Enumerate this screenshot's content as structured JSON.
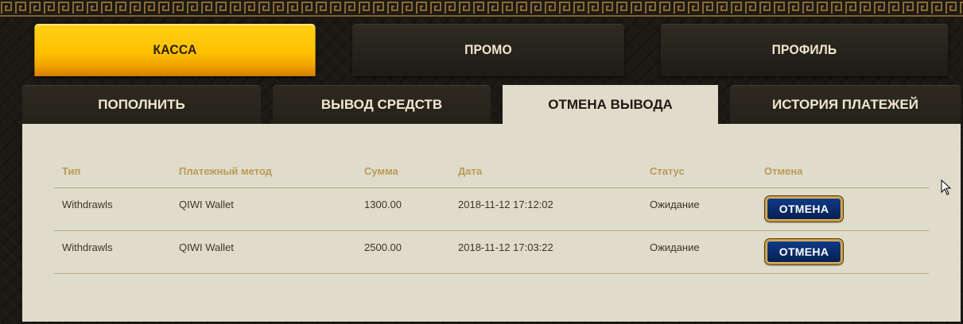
{
  "main_tabs": [
    {
      "label": "КАССА",
      "active": true
    },
    {
      "label": "ПРОМО",
      "active": false
    },
    {
      "label": "ПРОФИЛЬ",
      "active": false
    }
  ],
  "sub_tabs": [
    {
      "label": "ПОПОЛНИТЬ",
      "active": false
    },
    {
      "label": "ВЫВОД СРЕДСТВ",
      "active": false
    },
    {
      "label": "ОТМЕНА ВЫВОДА",
      "active": true
    },
    {
      "label": "ИСТОРИЯ ПЛАТЕЖЕЙ",
      "active": false
    }
  ],
  "table": {
    "headers": [
      "Тип",
      "Платежный метод",
      "Сумма",
      "Дата",
      "Статус",
      "Отмена"
    ],
    "rows": [
      {
        "type": "Withdrawls",
        "method": "QIWI Wallet",
        "amount": "1300.00",
        "date": "2018-11-12 17:12:02",
        "status": "Ожидание",
        "action": "ОТМЕНА"
      },
      {
        "type": "Withdrawls",
        "method": "QIWI Wallet",
        "amount": "2500.00",
        "date": "2018-11-12 17:03:22",
        "status": "Ожидание",
        "action": "ОТМЕНА"
      }
    ]
  },
  "colors": {
    "accent_gold": "#ffc000",
    "panel_bg": "#e0dccb",
    "header_text": "#b99a57",
    "button_blue": "#0a2a66"
  }
}
